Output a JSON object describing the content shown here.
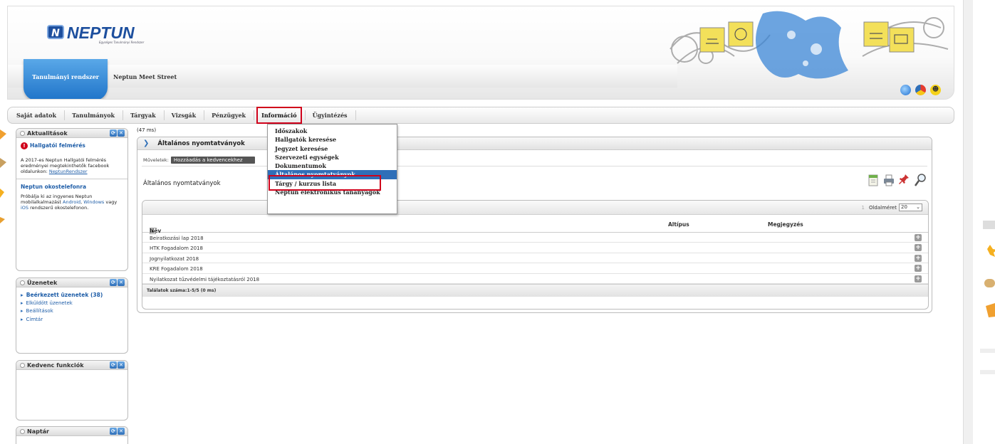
{
  "header": {
    "logo_text": "NEPTUN",
    "logo_subtitle": "Egységes Tanulmányi Rendszer",
    "site_tabs": [
      "Tanulmányi rendszer",
      "Neptun Meet Street"
    ]
  },
  "menu": [
    "Saját adatok",
    "Tanulmányok",
    "Tárgyak",
    "Vizsgák",
    "Pénzügyek",
    "Információ",
    "Ügyintézés"
  ],
  "dropdown": [
    "Időszakok",
    "Hallgatók keresése",
    "Jegyzet keresése",
    "Szervezeti egységek",
    "Dokumentumok",
    "Általános nyomtatványok",
    "Tárgy / kurzus lista",
    "Neptun elektronikus tananyagok"
  ],
  "left": {
    "news_title": "Aktualitások",
    "news1_title": "Hallgatói felmérés",
    "news1_text": "A 2017-es Neptun Hallgatói felmérés eredményei megtekinthetők facebook oldalunkon:",
    "news1_link": "NeptunRendszer",
    "news2_title": "Neptun okostelefonra",
    "news2_text_a": "Próbálja ki az ingyenes Neptun mobilalkalmazást",
    "news2_android": "Android",
    "news2_windows": "Windows",
    "news2_vagy": "vagy",
    "news2_ios": "iOS",
    "news2_text_b": "rendszerű okostelefonon.",
    "messages_title": "Üzenetek",
    "messages": [
      "Beérkezett üzenetek (38)",
      "Elküldött üzenetek",
      "Beállítások",
      "Címtár"
    ],
    "fav_title": "Kedvenc funkciók",
    "cal_title": "Naptár"
  },
  "main": {
    "ms": "(47 ms)",
    "panel_title": "Általános nyomtatványok",
    "actions_label": "Műveletek:",
    "fav_button": "Hozzáadás a kedvencekhez",
    "sub_title": "Általános nyomtatványok",
    "page_num": "1",
    "page_size_label": "Oldalméret",
    "page_size": "20",
    "columns": [
      "Név",
      "Altípus",
      "Megjegyzés"
    ],
    "rows": [
      "Beiratkozási lap 2018",
      "HTK Fogadalom 2018",
      "Jognyilatkozat 2018",
      "KRE Fogadalom 2018",
      "Nyilatkozat tűzvédelmi tájékoztatásról 2018"
    ],
    "footer": "Találatok száma:1-5/5 (0 ms)"
  }
}
